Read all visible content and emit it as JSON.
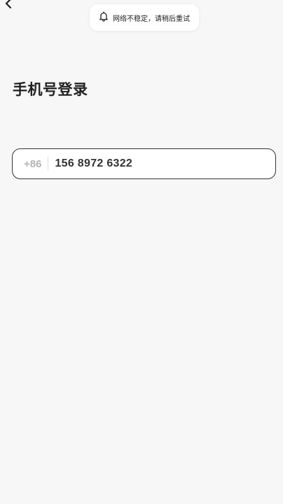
{
  "header": {
    "back_icon": "chevron-left-icon"
  },
  "toast": {
    "icon": "bell-icon",
    "message": "网络不稳定，请稍后重试"
  },
  "page": {
    "title": "手机号登录"
  },
  "phone_input": {
    "country_code": "+86",
    "value": "156 8972 6322"
  },
  "colors": {
    "background": "#f7f7f7",
    "field_border": "#333333",
    "placeholder_gray": "#b3b3b3",
    "text_dark": "#222222"
  }
}
